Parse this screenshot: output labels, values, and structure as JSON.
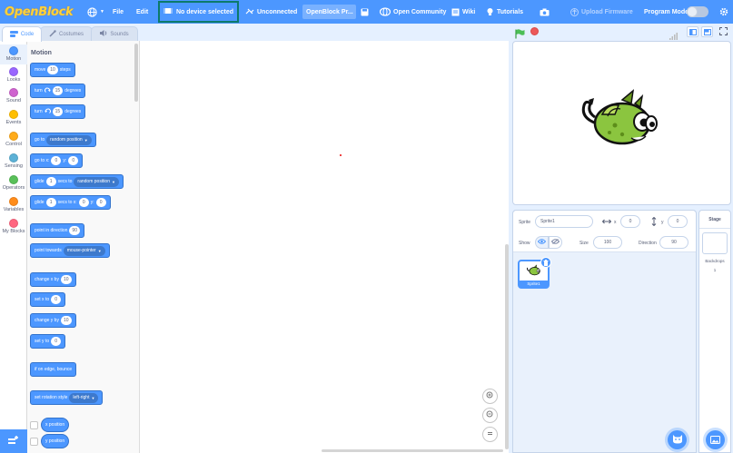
{
  "menu": {
    "logo": "OpenBlock",
    "file": "File",
    "edit": "Edit",
    "device": "No device selected",
    "connection": "Unconnected",
    "project_title": "OpenBlock Pr...",
    "community": "Open Community",
    "wiki": "Wiki",
    "tutorials": "Tutorials",
    "upload_firmware": "Upload Firmware",
    "program_mode": "Program Mode"
  },
  "tabs": [
    {
      "label": "Code",
      "icon": "code-icon"
    },
    {
      "label": "Costumes",
      "icon": "brush-icon"
    },
    {
      "label": "Sounds",
      "icon": "speaker-icon"
    }
  ],
  "categories": [
    {
      "label": "Motion",
      "color": "#4c97ff"
    },
    {
      "label": "Looks",
      "color": "#9966ff"
    },
    {
      "label": "Sound",
      "color": "#cf63cf"
    },
    {
      "label": "Events",
      "color": "#ffbf00"
    },
    {
      "label": "Control",
      "color": "#ffab19"
    },
    {
      "label": "Sensing",
      "color": "#5cb1d6"
    },
    {
      "label": "Operators",
      "color": "#59c059"
    },
    {
      "label": "Variables",
      "color": "#ff8c1a"
    },
    {
      "label": "My Blocks",
      "color": "#ff6680"
    }
  ],
  "palette": {
    "heading": "Motion",
    "move": {
      "a": "move",
      "v": "10",
      "b": "steps"
    },
    "turn_right": {
      "a": "turn",
      "v": "15",
      "b": "degrees"
    },
    "turn_left": {
      "a": "turn",
      "v": "15",
      "b": "degrees"
    },
    "go_to": {
      "a": "go to",
      "dd": "random position"
    },
    "go_to_xy": {
      "a": "go to x:",
      "x": "0",
      "b": "y:",
      "y": "0"
    },
    "glide_to": {
      "a": "glide",
      "v": "1",
      "b": "secs to",
      "dd": "random position"
    },
    "glide_xy": {
      "a": "glide",
      "v": "1",
      "b": "secs to x:",
      "x": "0",
      "c": "y:",
      "y": "0"
    },
    "point_dir": {
      "a": "point in direction",
      "v": "90"
    },
    "point_towards": {
      "a": "point towards",
      "dd": "mouse-pointer"
    },
    "change_x": {
      "a": "change x by",
      "v": "10"
    },
    "set_x": {
      "a": "set x to",
      "v": "0"
    },
    "change_y": {
      "a": "change y by",
      "v": "10"
    },
    "set_y": {
      "a": "set y to",
      "v": "0"
    },
    "bounce": {
      "a": "if on edge, bounce"
    },
    "rotation": {
      "a": "set rotation style",
      "dd": "left-right"
    },
    "x_pos": {
      "a": "x position"
    },
    "y_pos": {
      "a": "y position"
    }
  },
  "sprite_info": {
    "sprite_label": "Sprite",
    "sprite_name": "Sprite1",
    "x_label": "x",
    "x_value": "0",
    "y_label": "y",
    "y_value": "0",
    "show_label": "Show",
    "size_label": "Size",
    "size_value": "100",
    "direction_label": "Direction",
    "direction_value": "90"
  },
  "sprites": [
    {
      "name": "Sprite1",
      "selected": true
    }
  ],
  "stage_pane": {
    "heading": "Stage",
    "backdrops_label": "Backdrops",
    "backdrops_count": "1"
  },
  "colors": {
    "menu_bar": "#4c97ff",
    "device_outline": "#0c7a6b",
    "motion_block": "#4c97ff",
    "stop": "#ec5959",
    "flag": "#4cbf56"
  }
}
